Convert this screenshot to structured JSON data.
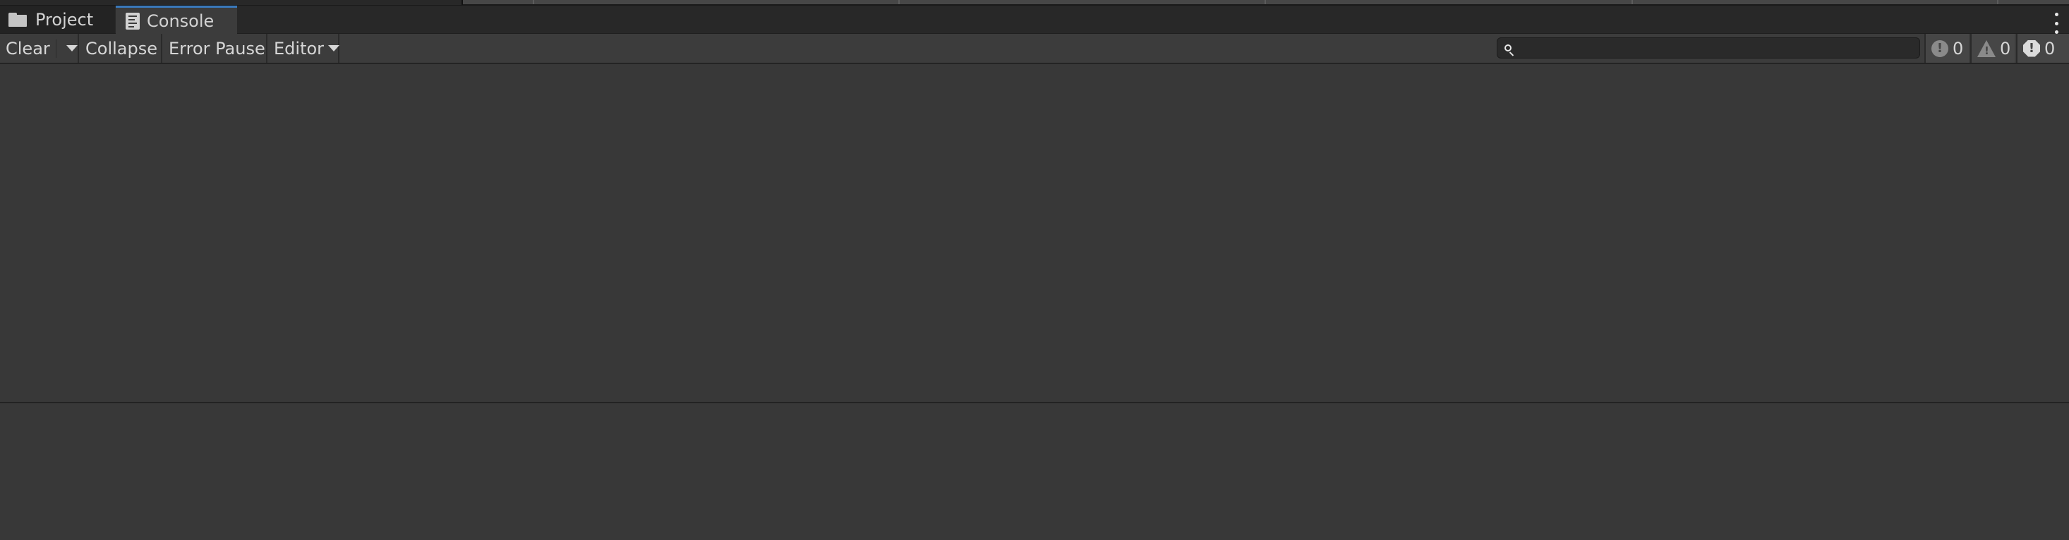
{
  "tabs": [
    {
      "label": "Project",
      "icon": "folder-icon",
      "active": false
    },
    {
      "label": "Console",
      "icon": "console-icon",
      "active": true
    }
  ],
  "toolbar": {
    "clear_label": "Clear",
    "collapse_label": "Collapse",
    "error_pause_label": "Error Pause",
    "editor_label": "Editor"
  },
  "search": {
    "value": "",
    "placeholder": ""
  },
  "counters": {
    "info": "0",
    "warning": "0",
    "error": "0"
  },
  "colors": {
    "active_tab_accent": "#3a79bb",
    "background": "#383838"
  }
}
